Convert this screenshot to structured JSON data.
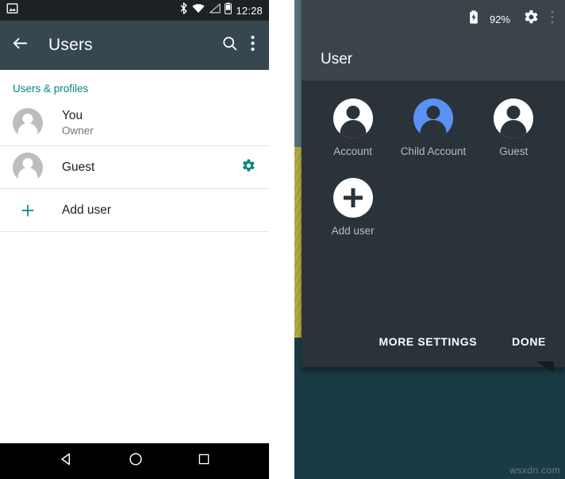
{
  "left_panel": {
    "status_bar": {
      "screenshot_icon": "image-icon",
      "bluetooth_icon": "bluetooth-icon",
      "wifi_icon": "wifi-icon",
      "signal_icon": "signal-icon",
      "battery_icon": "battery-icon",
      "clock": "12:28"
    },
    "appbar": {
      "back_icon": "back-arrow-icon",
      "title": "Users",
      "search_icon": "search-icon",
      "overflow_icon": "overflow-menu-icon"
    },
    "section_header": "Users & profiles",
    "rows": [
      {
        "title": "You",
        "subtitle": "Owner",
        "icon": "avatar-icon",
        "action": ""
      },
      {
        "title": "Guest",
        "subtitle": "",
        "icon": "avatar-icon",
        "action": "settings-gear-icon"
      },
      {
        "title": "Add user",
        "subtitle": "",
        "icon": "plus-icon",
        "action": ""
      }
    ],
    "nav_bar": {
      "back": "back-triangle-icon",
      "home": "home-circle-icon",
      "recents": "recents-square-icon"
    }
  },
  "right_panel": {
    "status_bar": {
      "battery_icon": "battery-charging-icon",
      "battery_text": "92%",
      "settings_icon": "gear-icon",
      "overflow_icon": "overflow-menu-icon"
    },
    "header_title": "User",
    "users": [
      {
        "label": "Account",
        "icon": "avatar-icon",
        "selected": false
      },
      {
        "label": "Child Account",
        "icon": "avatar-icon",
        "selected": true
      },
      {
        "label": "Guest",
        "icon": "avatar-icon",
        "selected": false
      },
      {
        "label": "Add user",
        "icon": "plus-icon",
        "selected": false
      }
    ],
    "buttons": {
      "more_settings": "MORE SETTINGS",
      "done": "DONE"
    }
  },
  "watermark": "wsxdn.com",
  "colors": {
    "accent_teal": "#00897b",
    "appbar": "#37474f",
    "status_bar": "#1d2124",
    "qs_panel": "#2a3339",
    "qs_header": "#3b434b",
    "selected_blue": "#5b91f5",
    "wallpaper_teal": "#1a3a45"
  }
}
